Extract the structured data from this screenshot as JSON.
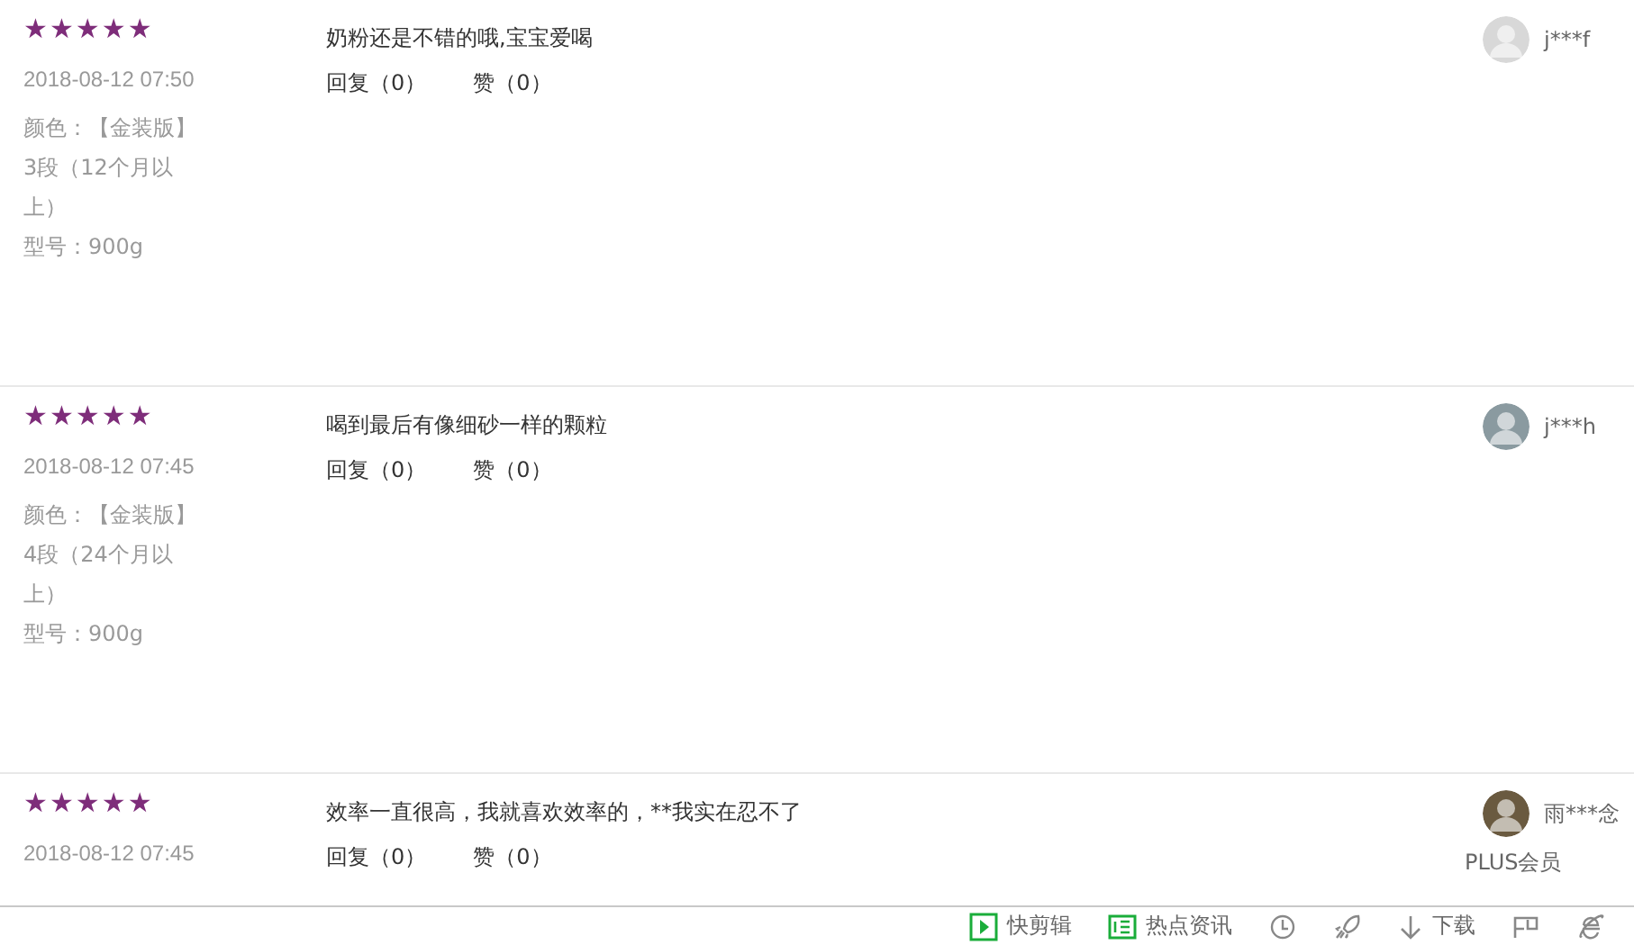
{
  "reviews": [
    {
      "stars": 5,
      "date": "2018-08-12 07:50",
      "attributes": [
        "颜色：【金装版】",
        "3段（12个月以上）",
        "型号：900g"
      ],
      "content": "奶粉还是不错的哦,宝宝爱喝",
      "reply": "回复（0）",
      "like": "赞（0）",
      "user": {
        "name": "j***f"
      }
    },
    {
      "stars": 5,
      "date": "2018-08-12 07:45",
      "attributes": [
        "颜色：【金装版】",
        "4段（24个月以上）",
        "型号：900g"
      ],
      "content": "喝到最后有像细砂一样的颗粒",
      "reply": "回复（0）",
      "like": "赞（0）",
      "user": {
        "name": "j***h"
      }
    },
    {
      "stars": 5,
      "date": "2018-08-12 07:45",
      "content": "效率一直很高，我就喜欢效率的，**我实在忍不了",
      "reply": "回复（0）",
      "like": "赞（0）",
      "user": {
        "name": "雨***念",
        "level": "PLUS会员"
      }
    }
  ],
  "status_bar": {
    "items": [
      {
        "kind": "clip",
        "label": "快剪辑"
      },
      {
        "kind": "news",
        "label": "热点资讯"
      },
      {
        "kind": "speed"
      },
      {
        "kind": "rocket"
      },
      {
        "kind": "download",
        "label": "下载"
      },
      {
        "kind": "flag"
      },
      {
        "kind": "ie"
      }
    ]
  }
}
